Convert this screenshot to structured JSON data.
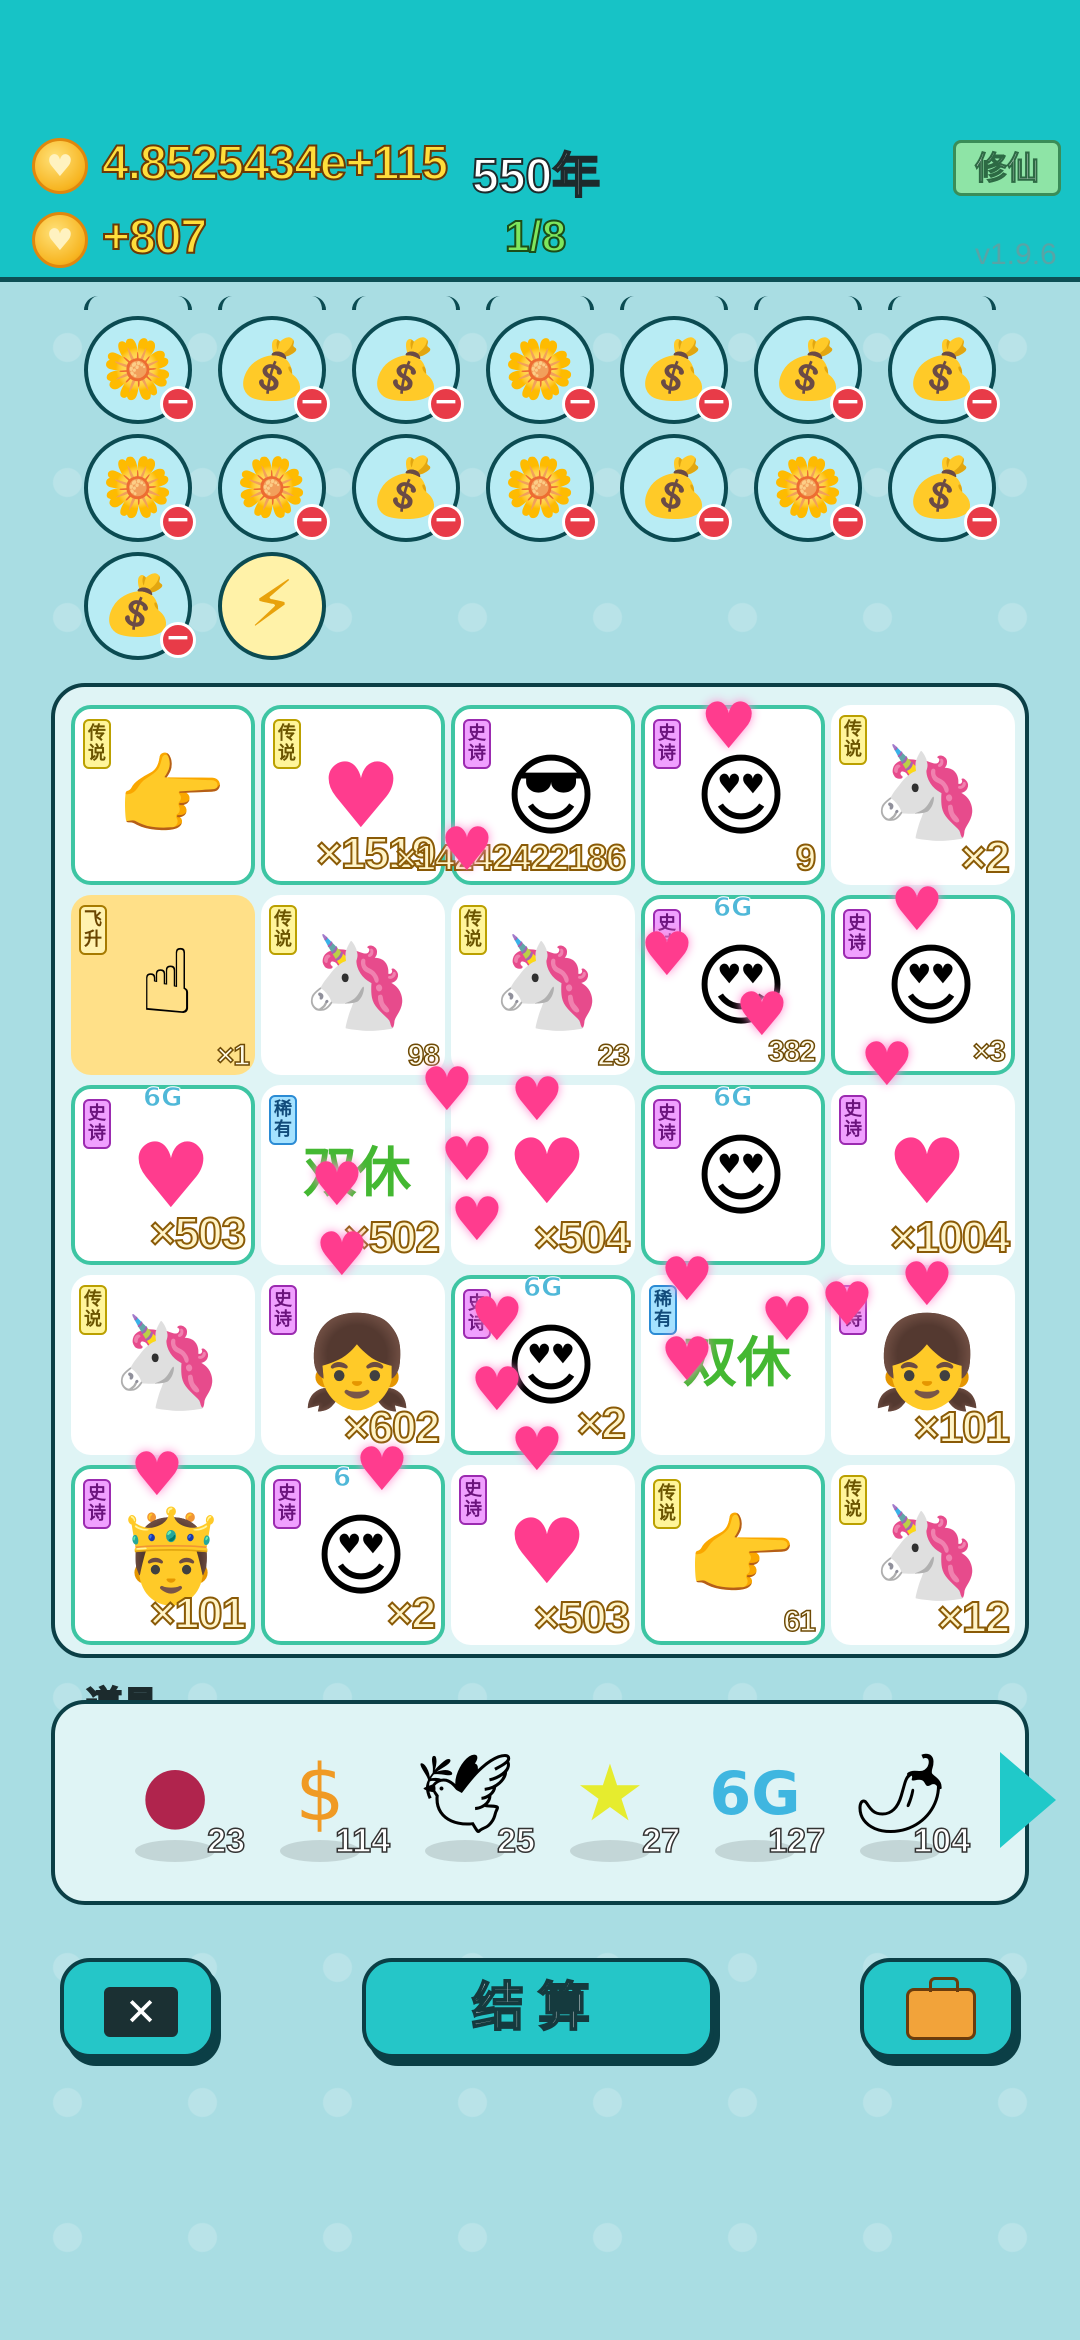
{
  "header": {
    "balance": "4.8525434e+115",
    "years": "550年",
    "income": "+807",
    "progress": "1/8",
    "cultivate_label": "修仙",
    "version": "v1.9.6"
  },
  "buffs": {
    "row1": [
      "flower-pot-icon",
      "money-bag-icon",
      "money-bag-icon",
      "flower-pot-icon",
      "money-bag-icon",
      "money-bag-icon",
      "money-bag-icon"
    ],
    "row2": [
      "flower-pot-icon",
      "flower-pot-icon",
      "money-bag-icon",
      "flower-pot-icon",
      "money-bag-icon",
      "flower-pot-icon",
      "money-bag-icon"
    ],
    "row3": [
      "money-bag-icon",
      "lightning-icon"
    ]
  },
  "board": {
    "cells": [
      {
        "tag": "传说",
        "icon": "pointing-hand-icon",
        "count": ""
      },
      {
        "tag": "传说",
        "icon": "heart-icon",
        "count": "×1519"
      },
      {
        "tag": "史诗",
        "icon": "king-sunglasses-icon",
        "count": "×14242422186"
      },
      {
        "tag": "史诗",
        "icon": "heart-eyes-face-icon",
        "count": "9"
      },
      {
        "tag": "传说",
        "icon": "unicorn-icon",
        "count": "×2"
      },
      {
        "tag": "飞升",
        "icon": "pointing-hand-icon",
        "count": "×1"
      },
      {
        "tag": "传说",
        "icon": "unicorn-icon",
        "count": "98"
      },
      {
        "tag": "传说",
        "icon": "unicorn-icon",
        "count": "23"
      },
      {
        "tag": "史诗",
        "icon": "heart-eyes-face-icon",
        "count": "382",
        "g6": "6G"
      },
      {
        "tag": "史诗",
        "icon": "heart-eyes-face-icon",
        "count": "×3"
      },
      {
        "tag": "史诗",
        "icon": "heart-icon",
        "count": "×503",
        "g6": "6G"
      },
      {
        "tag": "稀有",
        "icon": "double-rest-icon",
        "count": "×502"
      },
      {
        "tag": "",
        "icon": "heart-icon",
        "count": "×504"
      },
      {
        "tag": "史诗",
        "icon": "heart-eyes-face-icon",
        "count": "",
        "g6": "6G"
      },
      {
        "tag": "史诗",
        "icon": "heart-icon",
        "count": "×1004"
      },
      {
        "tag": "传说",
        "icon": "unicorn-icon",
        "count": ""
      },
      {
        "tag": "史诗",
        "icon": "braided-girl-icon",
        "count": "×602"
      },
      {
        "tag": "史诗",
        "icon": "heart-eyes-face-icon",
        "count": "×2",
        "g6": "6G"
      },
      {
        "tag": "稀有",
        "icon": "double-rest-icon",
        "count": ""
      },
      {
        "tag": "史诗",
        "icon": "braided-girl-icon",
        "count": "×101"
      },
      {
        "tag": "史诗",
        "icon": "bearded-king-icon",
        "count": "×101"
      },
      {
        "tag": "史诗",
        "icon": "heart-eyes-face-icon",
        "count": "×2",
        "g6": "6"
      },
      {
        "tag": "史诗",
        "icon": "heart-icon",
        "count": "×503"
      },
      {
        "tag": "传说",
        "icon": "pointing-hand-icon",
        "count": "61"
      },
      {
        "tag": "传说",
        "icon": "unicorn-icon",
        "count": "×12"
      }
    ]
  },
  "items": {
    "label": "道具",
    "list": [
      {
        "icon": "lychee-icon",
        "count": "23"
      },
      {
        "icon": "dollar-coin-icon",
        "count": "114"
      },
      {
        "icon": "white-bird-icon",
        "count": "25"
      },
      {
        "icon": "star-icon",
        "count": "27"
      },
      {
        "icon": "6g-icon",
        "count": "127"
      },
      {
        "icon": "chili-pepper-icon",
        "count": "104"
      }
    ]
  },
  "buttons": {
    "settle_label": "结算"
  },
  "colors": {
    "header_bg": "#17c3c6",
    "page_bg": "#a9dde3",
    "accent": "#25c6c8",
    "heart": "#ff3c8e",
    "count_text": "#fff4c8"
  }
}
